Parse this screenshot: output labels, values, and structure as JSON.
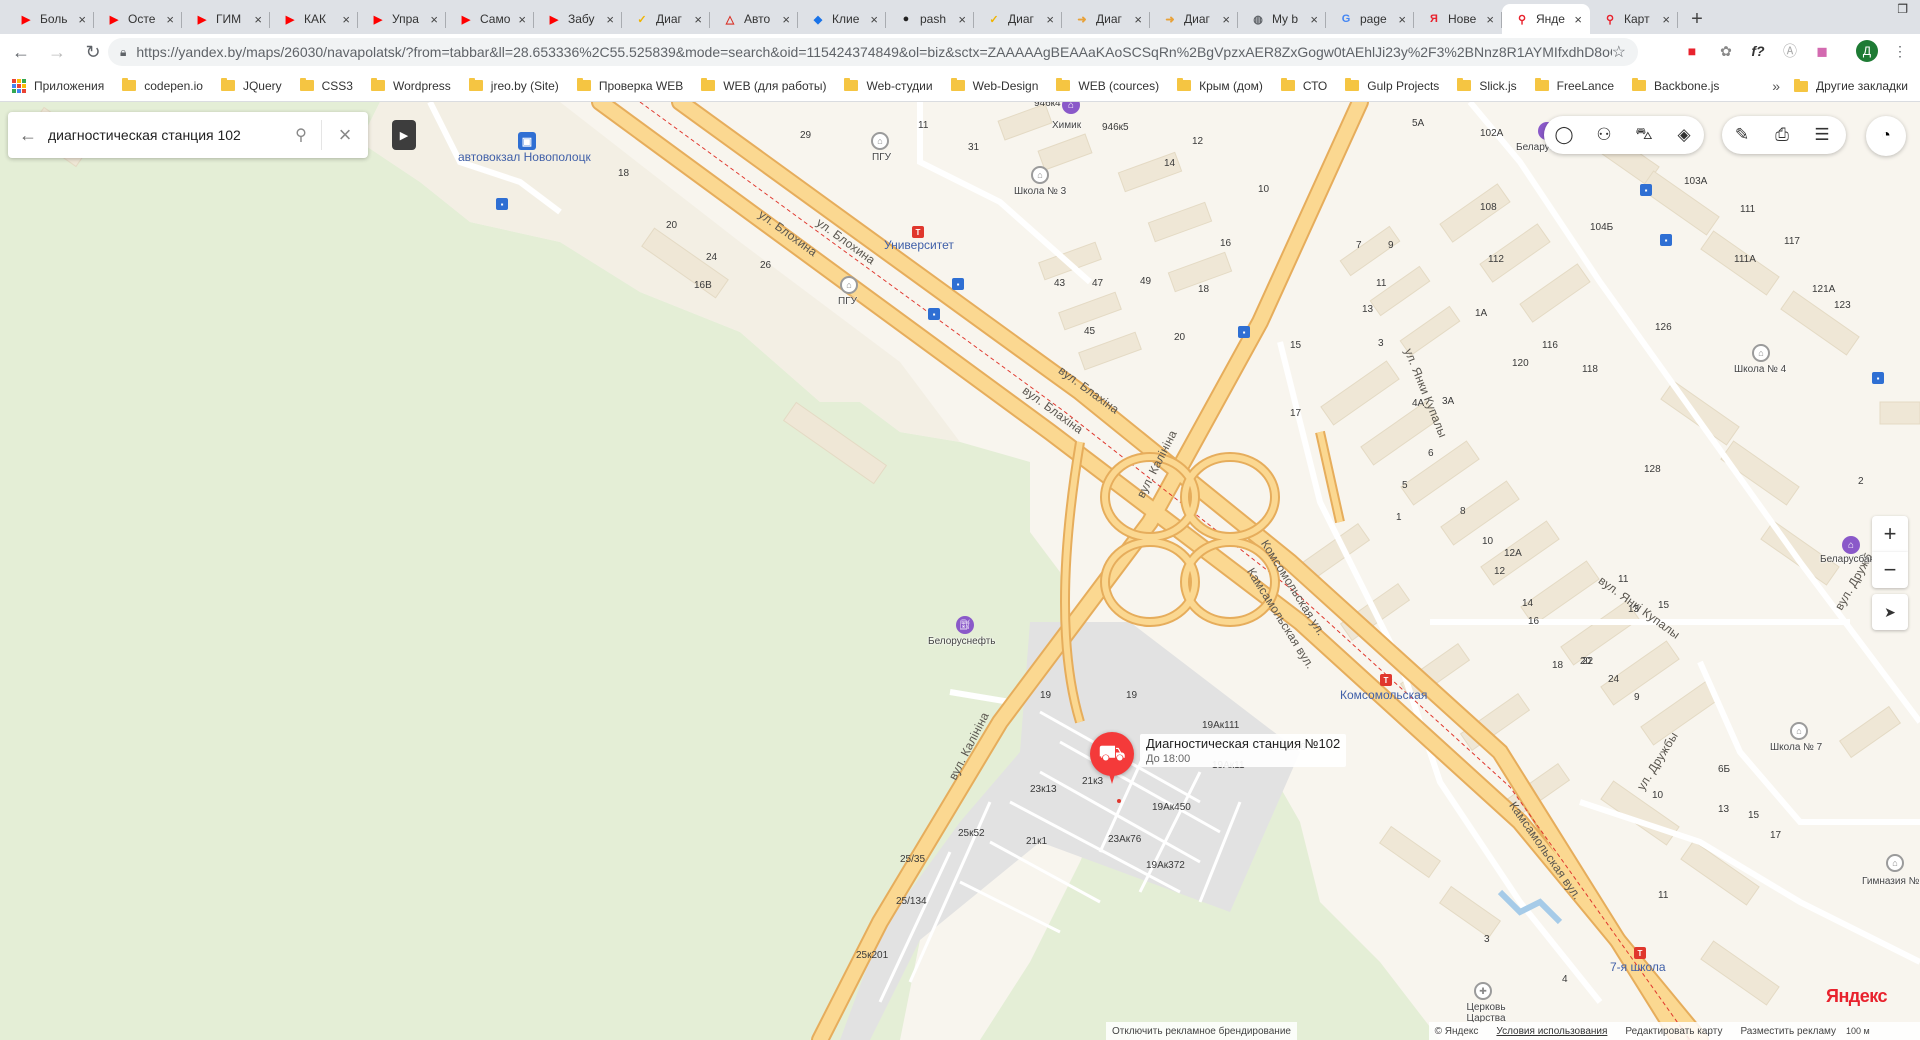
{
  "browser": {
    "tabs": [
      {
        "title": "Боль",
        "favicon": "youtube-icon",
        "fav_color": "#ff0000",
        "fav_glyph": "▶"
      },
      {
        "title": "Осте",
        "favicon": "youtube-icon",
        "fav_color": "#ff0000",
        "fav_glyph": "▶"
      },
      {
        "title": "ГИМ",
        "favicon": "youtube-icon",
        "fav_color": "#ff0000",
        "fav_glyph": "▶"
      },
      {
        "title": "КАК",
        "favicon": "youtube-icon",
        "fav_color": "#ff0000",
        "fav_glyph": "▶"
      },
      {
        "title": "Упра",
        "favicon": "youtube-icon",
        "fav_color": "#ff0000",
        "fav_glyph": "▶"
      },
      {
        "title": "Само",
        "favicon": "youtube-icon",
        "fav_color": "#ff0000",
        "fav_glyph": "▶"
      },
      {
        "title": "Забу",
        "favicon": "youtube-icon",
        "fav_color": "#ff0000",
        "fav_glyph": "▶"
      },
      {
        "title": "Диаг",
        "favicon": "check-badge-icon",
        "fav_color": "#f0b400",
        "fav_glyph": "✓"
      },
      {
        "title": "Авто",
        "favicon": "warning-icon",
        "fav_color": "#d93025",
        "fav_glyph": "△"
      },
      {
        "title": "Клие",
        "favicon": "drop-icon",
        "fav_color": "#1a73e8",
        "fav_glyph": "◆"
      },
      {
        "title": "pash",
        "favicon": "github-icon",
        "fav_color": "#222222",
        "fav_glyph": "●"
      },
      {
        "title": "Диаг",
        "favicon": "check-badge-icon",
        "fav_color": "#f0b400",
        "fav_glyph": "✓"
      },
      {
        "title": "Диаг",
        "favicon": "page-arrow-icon",
        "fav_color": "#e8a23a",
        "fav_glyph": "➜"
      },
      {
        "title": "Диаг",
        "favicon": "page-arrow-icon",
        "fav_color": "#e8a23a",
        "fav_glyph": "➜"
      },
      {
        "title": "My b",
        "favicon": "globe-icon",
        "fav_color": "#5f6368",
        "fav_glyph": "◍"
      },
      {
        "title": "page",
        "favicon": "google-icon",
        "fav_color": "#4285f4",
        "fav_glyph": "G"
      },
      {
        "title": "Нове",
        "favicon": "yandex-icon",
        "fav_color": "#e8222d",
        "fav_glyph": "Я"
      },
      {
        "title": "Янде",
        "favicon": "map-pin-icon",
        "fav_color": "#e8222d",
        "fav_glyph": "⚲",
        "active": true
      },
      {
        "title": "Карт",
        "favicon": "map-pin-icon",
        "fav_color": "#e8222d",
        "fav_glyph": "⚲"
      }
    ],
    "url": "https://yandex.by/maps/26030/navapolatsk/?from=tabbar&ll=28.653336%2C55.525839&mode=search&oid=115424374849&ol=biz&sctx=ZAAAAAgBEAAaKAoSCSqRn%2BgVpzxAER8ZxGogw0tAEhlJi23y%2F3%2BNnz8R1AYMIfxdhD8oCjA...",
    "bookmarks": [
      "Приложения",
      "codepen.io",
      "JQuery",
      "CSS3",
      "Wordpress",
      "jreo.by (Site)",
      "Проверка WEB",
      "WEB (для работы)",
      "Web-студии",
      "Web-Design",
      "WEB (cources)",
      "Крым (дом)",
      "СТО",
      "Gulp Projects",
      "Slick.js",
      "FreeLance",
      "Backbone.js"
    ],
    "bookmarks_more": "»",
    "other_bookmarks": "Другие закладки"
  },
  "search": {
    "query": "диагностическая станция 102"
  },
  "place": {
    "name": "Диагностическая станция №102",
    "hours": "До 18:00"
  },
  "streets": [
    {
      "text": "ул. Блохина"
    },
    {
      "text": "вул. Блахіна"
    },
    {
      "text": "ул. Блохина"
    },
    {
      "text": "вул. Блахіна"
    },
    {
      "text": "вул. Калініна"
    },
    {
      "text": "вул. Калініна"
    },
    {
      "text": "Комсомольская ул."
    },
    {
      "text": "Камсамольская вул."
    },
    {
      "text": "Камсамольская вул."
    },
    {
      "text": "ул. Янки Купалы"
    },
    {
      "text": "вул. Янкі Купалы"
    },
    {
      "text": "ул. Дружбы"
    },
    {
      "text": "вул. Дружб"
    }
  ],
  "pois": {
    "avtovokzal": "автовокзал Новополоцк",
    "pgu1": "ПГУ",
    "pgu2": "ПГУ",
    "school3": "Школа № 3",
    "himik": "Химик",
    "universitet": "Университет",
    "belarusbank1": "Беларусбанк",
    "belarusbank2": "Беларусбан",
    "school4": "Школа № 4",
    "school7": "Школа № 7",
    "gymnasium": "Гимназия №",
    "belorusneft": "Белоруснефть",
    "komsomolskaya": "Комсомольская",
    "school_7ya": "7-я школа",
    "church": "Церковь Царства"
  },
  "house_numbers": [
    "6",
    "29",
    "18",
    "20",
    "24",
    "26",
    "16В",
    "11",
    "31",
    "946к4",
    "946к5",
    "12",
    "14",
    "10",
    "16",
    "18",
    "20",
    "43",
    "47",
    "49",
    "45",
    "5А",
    "102А",
    "108",
    "104Б",
    "103А",
    "111",
    "117",
    "121А",
    "111А",
    "123",
    "112",
    "116",
    "118",
    "126",
    "120",
    "1А",
    "13",
    "15",
    "17",
    "7",
    "9",
    "11",
    "3",
    "4А",
    "3А",
    "1",
    "128",
    "2",
    "5",
    "6",
    "8",
    "10",
    "12",
    "12А",
    "14",
    "16",
    "18",
    "20",
    "22",
    "24",
    "9",
    "11",
    "13",
    "15",
    "6Б",
    "10",
    "13",
    "15",
    "17",
    "3",
    "4",
    "19",
    "21к1",
    "21к3",
    "23к13",
    "23Ак76",
    "19Ак111",
    "19Ак11",
    "196к206",
    "19Ак450",
    "19Ак372",
    "25к52",
    "25/35",
    "25/134",
    "25к201",
    "19",
    "11"
  ],
  "controls": {
    "zoom_in": "+",
    "zoom_out": "−"
  },
  "footer": {
    "ad_off": "Отключить рекламное брендирование",
    "copyright": "© Яндекс",
    "terms": "Условия использования",
    "edit_map": "Редактировать карту",
    "place_ad": "Разместить рекламу",
    "scale": "100 м",
    "logo": "Яндекс"
  },
  "colors": {
    "map_bg": "#f8f5ee",
    "forest": "#e3eed3",
    "road_major": "#f7c974",
    "road_outline": "#e2a95a",
    "building": "#efe8d9",
    "accent_red": "#f43a3a",
    "bus_blue": "#2f6fd3"
  }
}
